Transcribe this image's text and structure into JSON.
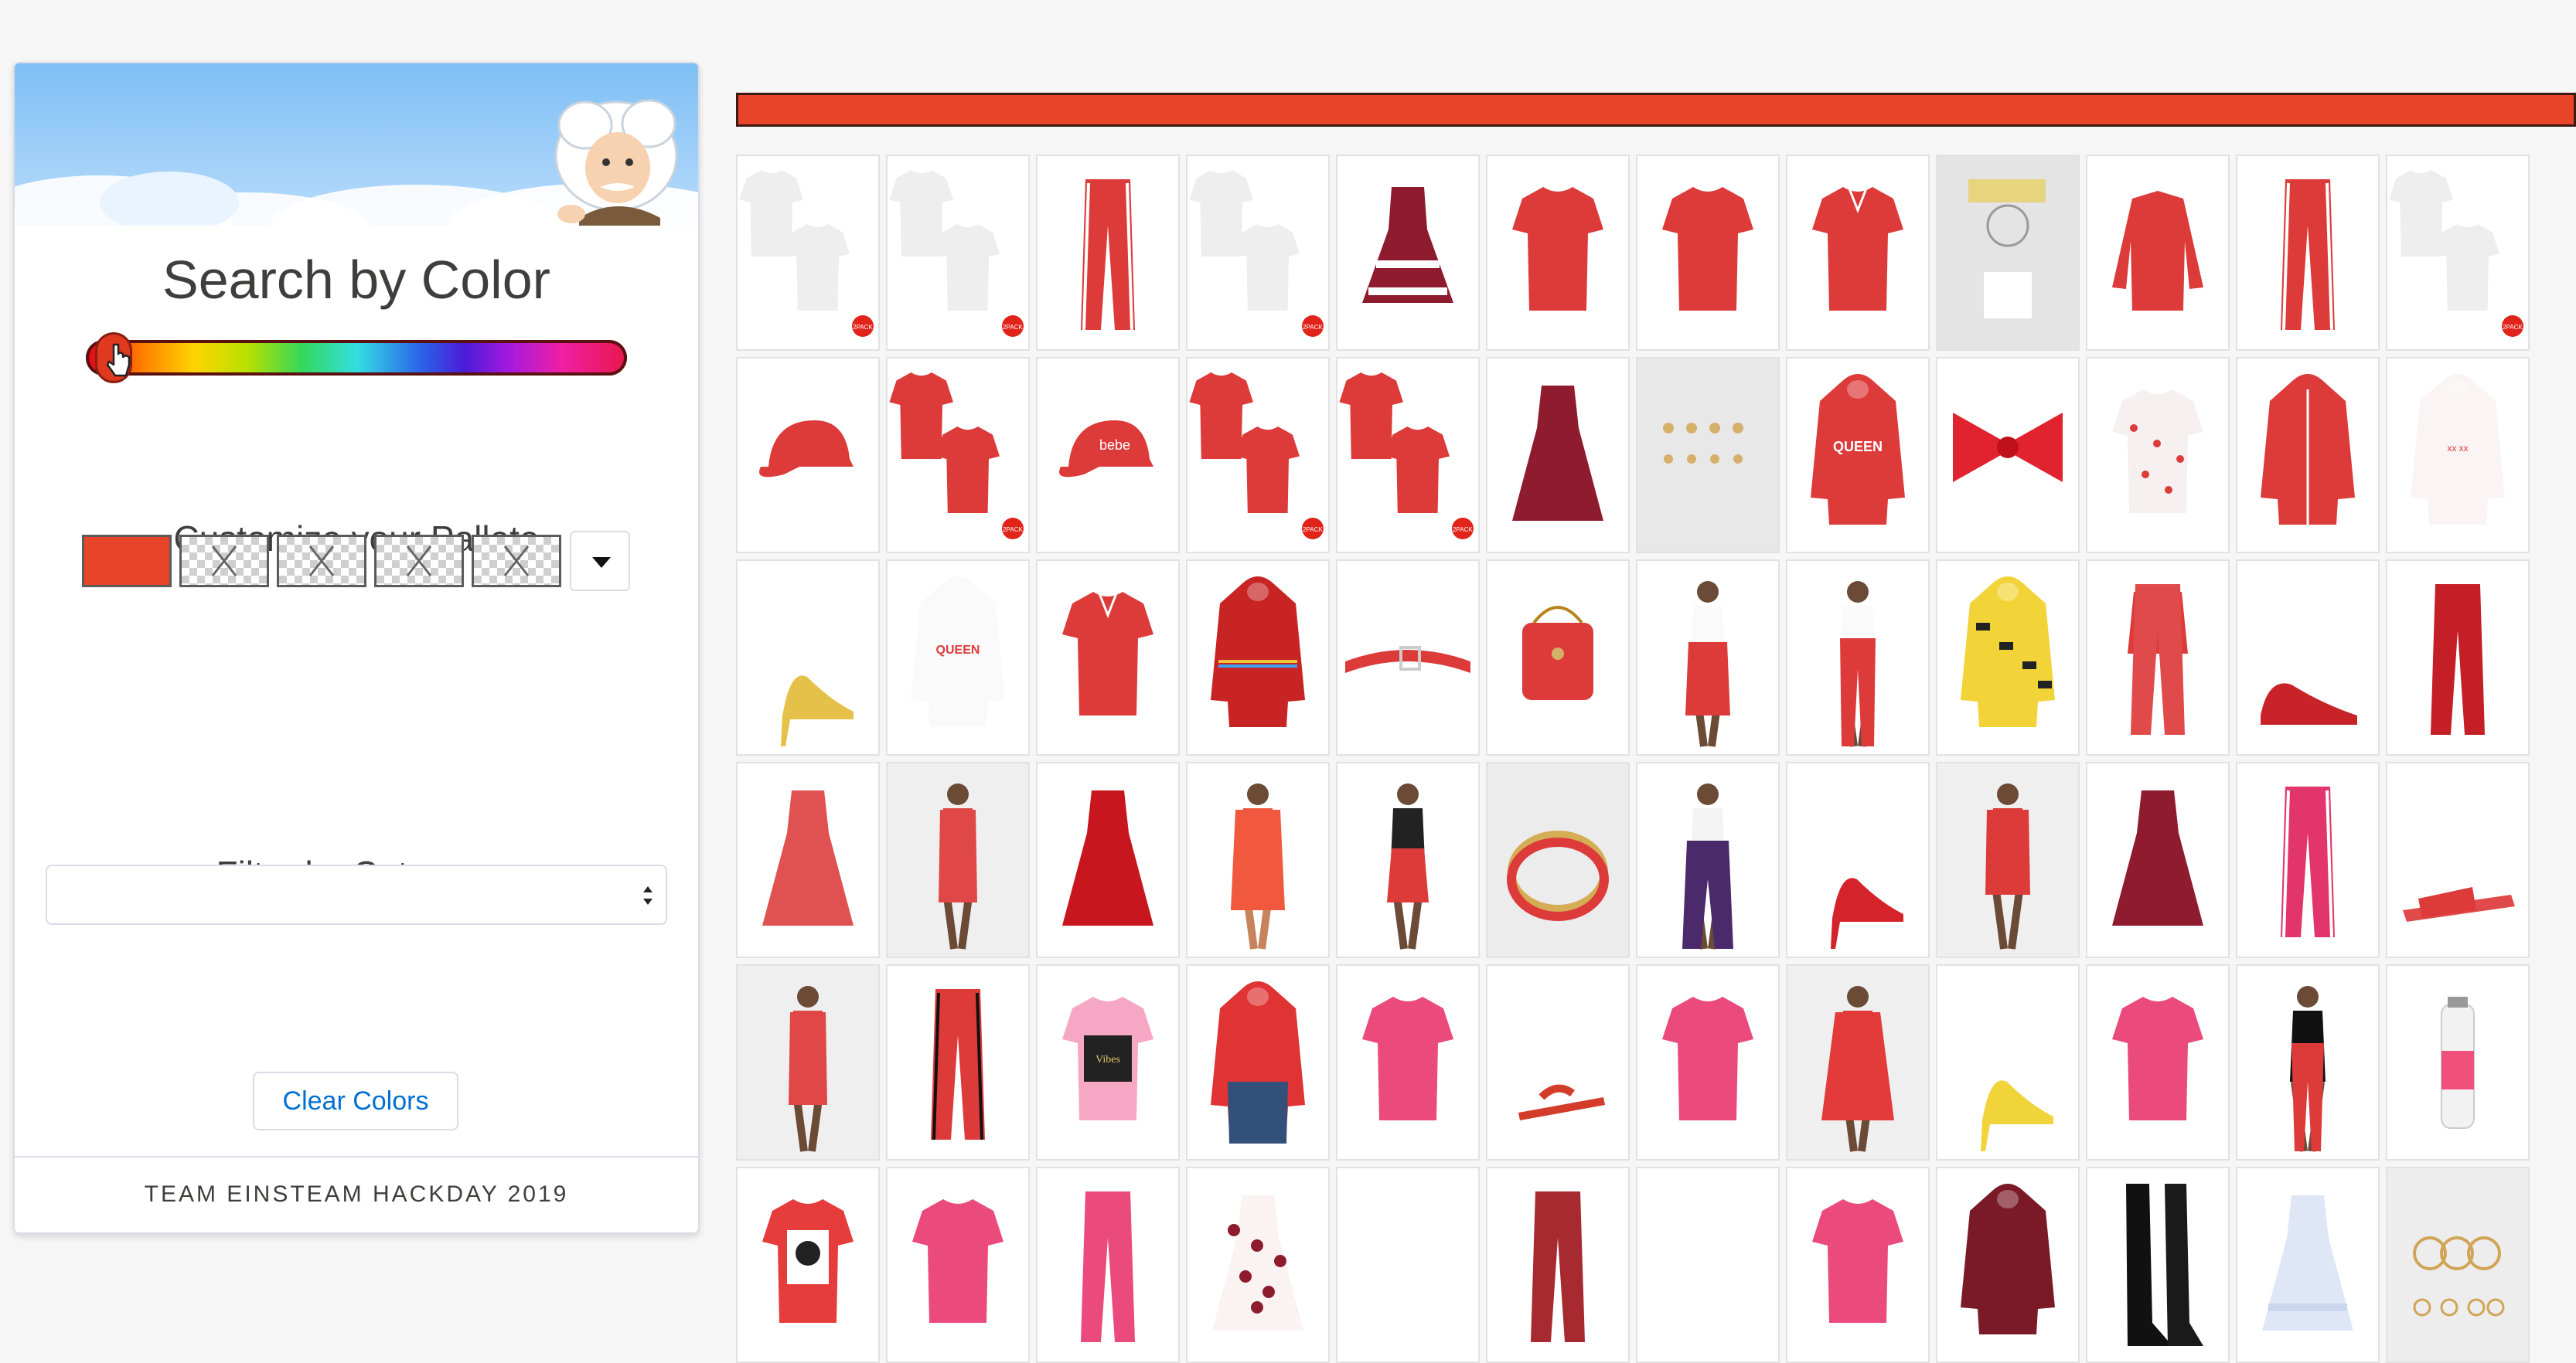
{
  "sidebar": {
    "title": "Search by Color",
    "palette_label": "Customize your Pallete",
    "palette_swatches": [
      "#e8442a",
      "empty",
      "empty",
      "empty",
      "empty"
    ],
    "filter_label": "Filter by Category",
    "category_value": "",
    "clear_button": "Clear Colors",
    "footer": "TEAM EINSTEAM HACKDAY 2019",
    "slider_position": 0.03
  },
  "colors": {
    "selected": "#e8442a",
    "link": "#0070d2",
    "border": "#d8dde6"
  },
  "products": [
    [
      "white-polo-2pack",
      "white-polo-2pack",
      "red-striped-pants",
      "white-polo-2pack",
      "red-white-dress",
      "red-tee",
      "red-tee",
      "red-polo",
      "candy-keychain",
      "red-longsleeve",
      "red-striped-pants",
      "white-polo-2pack"
    ],
    [
      "red-cap",
      "red-polo-2pack",
      "red-cap-embroidered",
      "red-polo-2pack",
      "red-polo-2pack",
      "burgundy-dress",
      "earrings-set",
      "queen-hoodie",
      "red-hair-bow",
      "cherry-print-tee",
      "red-track-jacket",
      "white-print-hoodie"
    ],
    [
      "yellow-heel",
      "white-queen-hoodie",
      "red-polo",
      "rainbow-stripe-hoodie",
      "red-belt",
      "red-handbag",
      "suspender-skirt",
      "suspender-pants",
      "yellow-print-hoodie",
      "red-pajama-set",
      "red-sneaker",
      "red-jeans"
    ],
    [
      "red-midi-dress",
      "red-bodycon-dress",
      "red-skater-dress",
      "red-robe",
      "red-skirt",
      "gold-bangles",
      "purple-pants",
      "red-pump",
      "red-off-shoulder-dress",
      "burgundy-dress",
      "pink-jeans",
      "red-slide"
    ],
    [
      "red-bodycon-dress",
      "red-joggers",
      "vibes-tee",
      "red-graphic-hoodie",
      "pink-tee",
      "red-sandal",
      "pink-tee",
      "red-print-dress",
      "yellow-sandal",
      "pink-tee",
      "red-leggings",
      "pink-bottle"
    ],
    [
      "graphic-tee",
      "pink-tee",
      "pink-pants",
      "floral-dress",
      "blank",
      "red-cargo-pants",
      "blank",
      "pink-tee",
      "burgundy-hoodie",
      "black-boots",
      "ruffle-shirt-dress",
      "gold-hoops"
    ]
  ]
}
